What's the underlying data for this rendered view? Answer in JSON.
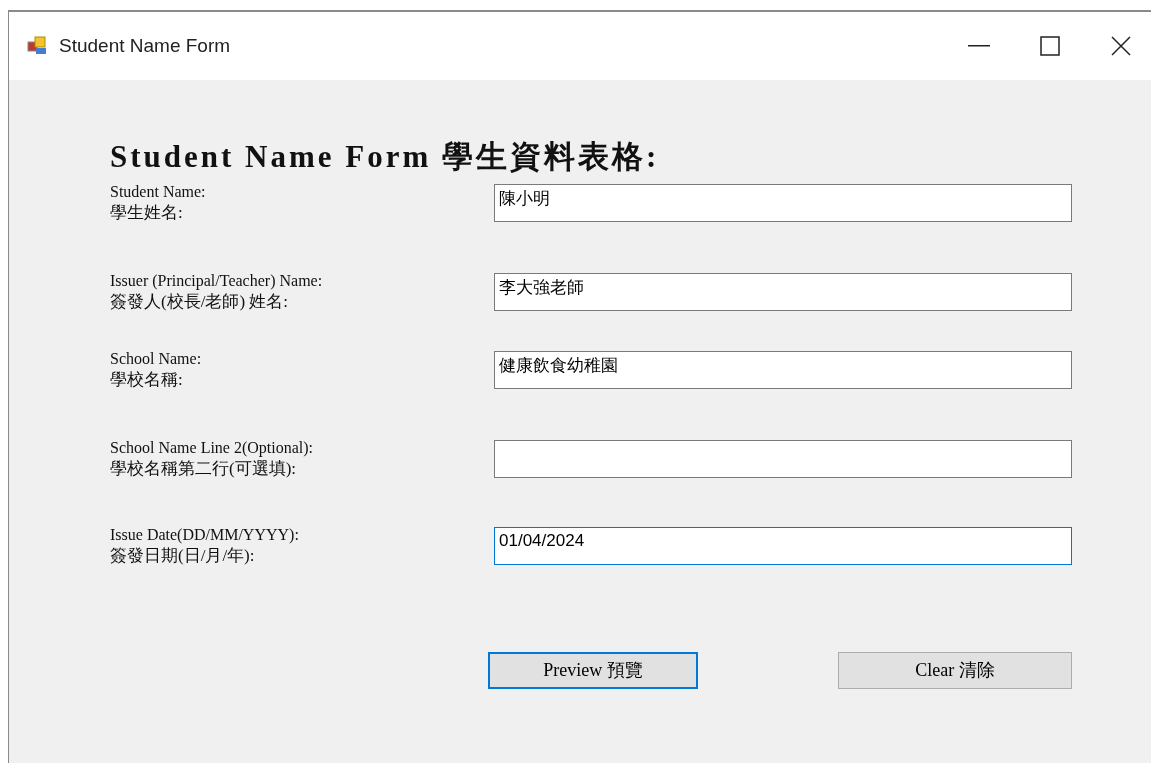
{
  "window": {
    "title": "Student Name Form"
  },
  "heading": "Student Name Form 學生資料表格:",
  "fields": [
    {
      "label": "Student Name:",
      "label_zh": "學生姓名:",
      "value": "陳小明",
      "focused": false
    },
    {
      "label": "Issuer (Principal/Teacher) Name:",
      "label_zh": "簽發人(校長/老師) 姓名:",
      "value": "李大強老師",
      "focused": false
    },
    {
      "label": "School Name:",
      "label_zh": "學校名稱:",
      "value": "健康飲食幼稚園",
      "focused": false
    },
    {
      "label": "School Name Line 2(Optional):",
      "label_zh": "學校名稱第二行(可選填):",
      "focused": false
    },
    {
      "label": "Issue Date(DD/MM/YYYY):",
      "label_zh": "簽發日期(日/月/年):",
      "value": "01/04/2024",
      "focused": true
    }
  ],
  "buttons": [
    {
      "label": "Preview 預覽",
      "default": true
    },
    {
      "label": "Clear 清除",
      "default": false
    }
  ]
}
